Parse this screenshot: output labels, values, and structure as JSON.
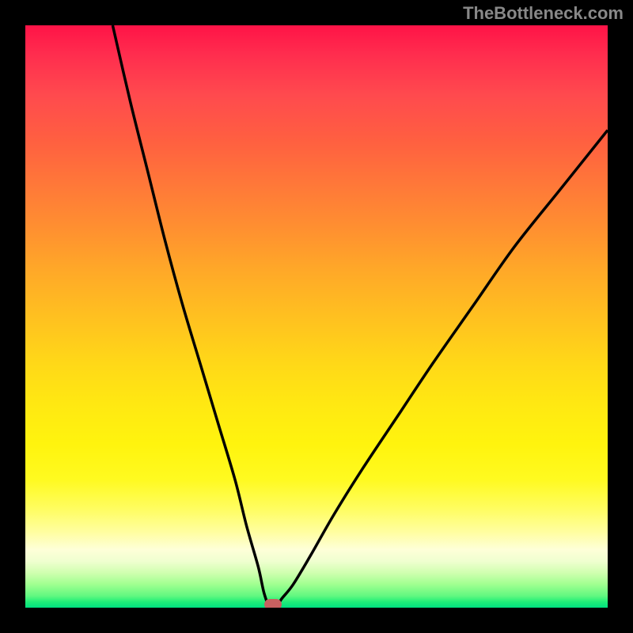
{
  "watermark": "TheBottleneck.com",
  "chart_data": {
    "type": "line",
    "title": "",
    "xlabel": "",
    "ylabel": "",
    "xlim": [
      0,
      100
    ],
    "ylim": [
      0,
      100
    ],
    "description": "V-shaped bottleneck curve with minimum around x=42",
    "series": [
      {
        "name": "bottleneck-curve",
        "x": [
          15,
          18,
          21,
          24,
          27,
          30,
          33,
          36,
          38,
          40,
          41,
          42,
          43,
          44,
          46,
          49,
          53,
          58,
          64,
          70,
          77,
          84,
          92,
          100
        ],
        "values": [
          100,
          87,
          75,
          63,
          52,
          42,
          32,
          22,
          14,
          7,
          2.5,
          0,
          0,
          1.5,
          4,
          9,
          16,
          24,
          33,
          42,
          52,
          62,
          72,
          82
        ]
      }
    ],
    "marker": {
      "x": 42.5,
      "y": 0,
      "color": "#c76060"
    },
    "gradient_colors": {
      "top": "#ff1347",
      "middle": "#ffd818",
      "bottom": "#00e080"
    }
  }
}
